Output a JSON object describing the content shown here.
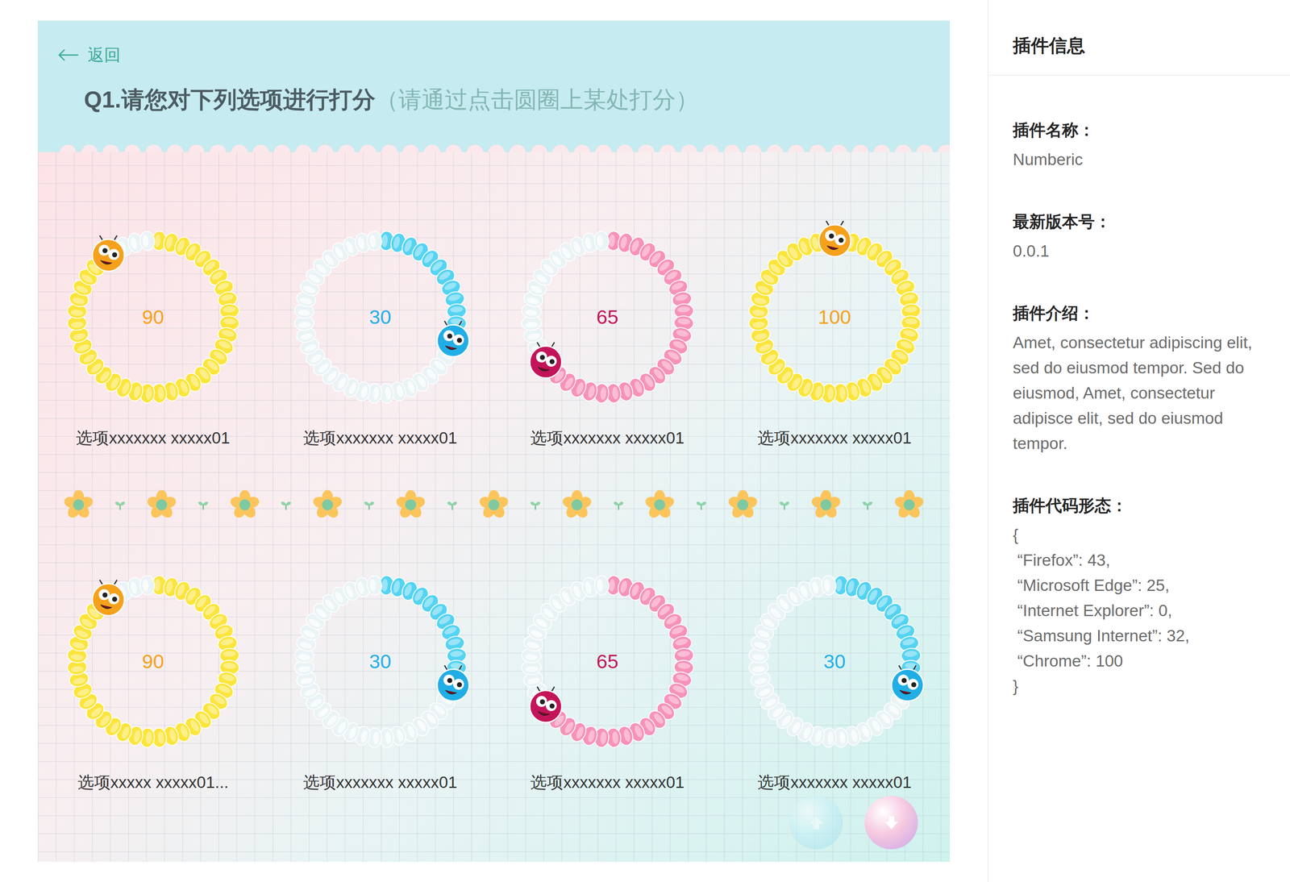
{
  "back": {
    "label": "返回"
  },
  "question": {
    "title": "Q1.请您对下列选项进行打分",
    "hint": "（请通过点击圆圈上某处打分）"
  },
  "rows": [
    [
      {
        "label": "选项xxxxxxx xxxxx01",
        "score": "90",
        "level": 0.9,
        "color": "#fbe53c",
        "accent": "#f5a11c"
      },
      {
        "label": "选项xxxxxxx xxxxx01",
        "score": "30",
        "level": 0.3,
        "color": "#55d3f2",
        "accent": "#21aee6"
      },
      {
        "label": "选项xxxxxxx xxxxx01",
        "score": "65",
        "level": 0.65,
        "color": "#f792b8",
        "accent": "#c3145a"
      },
      {
        "label": "选项xxxxxxx xxxxx01",
        "score": "100",
        "level": 1.0,
        "color": "#fbe53c",
        "accent": "#f5a11c"
      }
    ],
    [
      {
        "label": "选项xxxxx xxxxx01...",
        "score": "90",
        "level": 0.9,
        "color": "#fbe53c",
        "accent": "#f5a11c"
      },
      {
        "label": "选项xxxxxxx xxxxx01",
        "score": "30",
        "level": 0.3,
        "color": "#55d3f2",
        "accent": "#21aee6"
      },
      {
        "label": "选项xxxxxxx xxxxx01",
        "score": "65",
        "level": 0.65,
        "color": "#f792b8",
        "accent": "#c3145a"
      },
      {
        "label": "选项xxxxxxx xxxxx01",
        "score": "30",
        "level": 0.3,
        "color": "#55d3f2",
        "accent": "#21aee6"
      }
    ]
  ],
  "pager": [
    {
      "kind": "up",
      "disabled": true
    },
    {
      "kind": "down",
      "disabled": false
    }
  ],
  "plugin_info": {
    "title": "插件信息",
    "fields": [
      {
        "label": "插件名称：",
        "kind": "text",
        "value": "Numberic"
      },
      {
        "label": "最新版本号：",
        "kind": "text",
        "value": "0.0.1"
      },
      {
        "label": "插件介绍：",
        "kind": "text",
        "value": "Amet, consectetur adipiscing elit, sed do eiusmod tempor. Sed do eiusmod, Amet, consectetur adipisce elit, sed do eiusmod tempor."
      },
      {
        "label": "插件代码形态：",
        "kind": "code",
        "lines": [
          "{",
          " “Firefox”: 43,",
          " “Microsoft Edge”: 25,",
          " “Internet Explorer”: 0,",
          " “Samsung Internet”: 32,",
          " “Chrome”: 100",
          "}"
        ]
      }
    ]
  }
}
